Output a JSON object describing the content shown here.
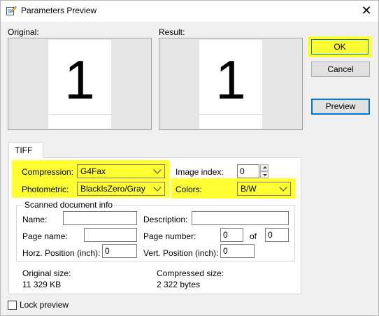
{
  "window": {
    "title": "Parameters Preview",
    "close_glyph": "✕",
    "icon": "edit-document-icon"
  },
  "preview": {
    "original_label": "Original:",
    "result_label": "Result:",
    "original_page_number": "1",
    "result_page_number": "1"
  },
  "buttons": {
    "ok": "OK",
    "cancel": "Cancel",
    "preview": "Preview"
  },
  "tabs": [
    {
      "label": "TIFF",
      "selected": true
    }
  ],
  "tiff": {
    "compression_label": "Compression:",
    "compression_value": "G4Fax",
    "photometric_label": "Photometric:",
    "photometric_value": "BlackIsZero/Gray",
    "image_index_label": "Image index:",
    "image_index_value": "0",
    "colors_label": "Colors:",
    "colors_value": "B/W"
  },
  "scanned_info": {
    "group_title": "Scanned document info",
    "name_label": "Name:",
    "name_value": "",
    "description_label": "Description:",
    "description_value": "",
    "page_name_label": "Page name:",
    "page_name_value": "",
    "page_number_label": "Page number:",
    "page_number_value": "0",
    "of_label": "of",
    "page_total_value": "0",
    "horz_position_label": "Horz. Position (inch):",
    "horz_position_value": "0",
    "vert_position_label": "Vert. Position (inch):",
    "vert_position_value": "0"
  },
  "sizes": {
    "original_size_label": "Original size:",
    "original_size_value": "11 329 KB",
    "compressed_size_label": "Compressed size:",
    "compressed_size_value": "2 322 bytes"
  },
  "lock_preview": {
    "label": "Lock preview",
    "checked": false
  },
  "colors": {
    "highlight": "#ffff33",
    "accent": "#0078d7",
    "dialog_bg": "#f0f0f0"
  }
}
